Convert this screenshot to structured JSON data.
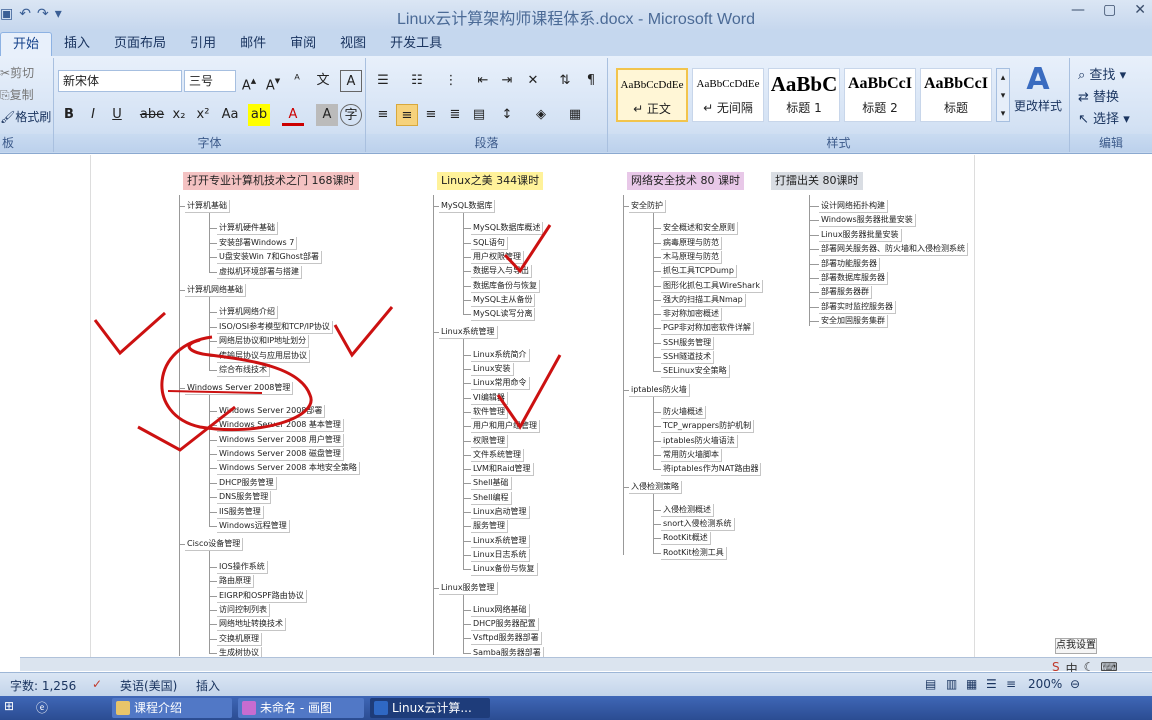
{
  "window": {
    "title": "Linux云计算架构师课程体系.docx - Microsoft Word"
  },
  "tabs": [
    "开始",
    "插入",
    "页面布局",
    "引用",
    "邮件",
    "审阅",
    "视图",
    "开发工具"
  ],
  "clipboard": {
    "cut": "剪切",
    "copy": "复制",
    "painter": "格式刷",
    "label": "板"
  },
  "font": {
    "name": "新宋体",
    "size": "三号",
    "label": "字体"
  },
  "paragraph": {
    "label": "段落"
  },
  "styles": {
    "label": "样式",
    "items": [
      {
        "sample": "AaBbCcDdEe",
        "name": "↵ 正文"
      },
      {
        "sample": "AaBbCcDdEe",
        "name": "↵ 无间隔"
      },
      {
        "sample": "AaBbC",
        "name": "标题 1"
      },
      {
        "sample": "AaBbCcI",
        "name": "标题 2"
      },
      {
        "sample": "AaBbCcI",
        "name": "标题"
      }
    ],
    "change": "更改样式"
  },
  "editing": {
    "find": "查找",
    "replace": "替换",
    "select": "选择",
    "label": "编辑"
  },
  "mindmap": {
    "col1": {
      "title": "打开专业计算机技术之门 168课时",
      "groups": [
        {
          "name": "计算机基础",
          "items": [
            "计算机硬件基础",
            "安装部署Windows 7",
            "U盘安装Win 7和Ghost部署",
            "虚拟机环境部署与搭建"
          ]
        },
        {
          "name": "计算机网络基础",
          "items": [
            "计算机网络介绍",
            "ISO/OSI参考模型和TCP/IP协议",
            "网络层协议和IP地址划分",
            "传输层协议与应用层协议",
            "综合布线技术"
          ]
        },
        {
          "name": "Windows Server 2008管理",
          "items": [
            "Windows Server 2008部署",
            "Windows Server 2008 基本管理",
            "Windows Server 2008 用户管理",
            "Windows Server 2008 磁盘管理",
            "Windows Server 2008 本地安全策略",
            "DHCP服务管理",
            "DNS服务管理",
            "IIS服务管理",
            "Windows远程管理"
          ]
        },
        {
          "name": "Cisco设备管理",
          "items": [
            "IOS操作系统",
            "路由原理",
            "EIGRP和OSPF路由协议",
            "访问控制列表",
            "网络地址转换技术",
            "交换机原理",
            "生成树协议"
          ]
        }
      ]
    },
    "col2": {
      "title": "Linux之美 344课时",
      "groups": [
        {
          "name": "MySQL数据库",
          "items": [
            "MySQL数据库概述",
            "SQL语句",
            "用户权限管理",
            "数据导入与导出",
            "数据库备份与恢复",
            "MySQL主从备份",
            "MySQL读写分离"
          ]
        },
        {
          "name": "Linux系统管理",
          "items": [
            "Linux系统简介",
            "Linux安装",
            "Linux常用命令",
            "VI编辑器",
            "软件管理",
            "用户和用户组管理",
            "权限管理",
            "文件系统管理",
            "LVM和Raid管理",
            "Shell基础",
            "Shell编程",
            "Linux启动管理",
            "服务管理",
            "Linux系统管理",
            "Linux日志系统",
            "Linux备份与恢复"
          ]
        },
        {
          "name": "Linux服务管理",
          "items": [
            "Linux网络基础",
            "DHCP服务器配置",
            "Vsftpd服务器部署",
            "Samba服务器部署"
          ]
        }
      ]
    },
    "col3": {
      "title": "网络安全技术 80 课时",
      "groups": [
        {
          "name": "安全防护",
          "items": [
            "安全概述和安全原则",
            "病毒原理与防范",
            "木马原理与防范",
            "抓包工具TCPDump",
            "图形化抓包工具WireShark",
            "强大的扫描工具Nmap",
            "非对称加密概述",
            "PGP非对称加密软件详解",
            "SSH服务管理",
            "SSH隧道技术",
            "SELinux安全策略"
          ]
        },
        {
          "name": "iptables防火墙",
          "items": [
            "防火墙概述",
            "TCP_wrappers防护机制",
            "iptables防火墙语法",
            "常用防火墙脚本",
            "将iptables作为NAT路由器"
          ]
        },
        {
          "name": "入侵检测策略",
          "items": [
            "入侵检测概述",
            "snort入侵检测系统",
            "RootKit概述",
            "RootKit检测工具"
          ]
        }
      ]
    },
    "col4": {
      "title": "打擂出关 80课时",
      "items": [
        "设计网络拓扑构建",
        "Windows服务器批量安装",
        "Linux服务器批量安装",
        "部署网关服务器、防火墙和入侵检测系统",
        "部署功能服务器",
        "部署数据库服务器",
        "部署服务器群",
        "部署实时监控服务器",
        "安全加固服务集群"
      ]
    }
  },
  "status": {
    "words": "字数: 1,256",
    "lang": "英语(美国)",
    "mode": "插入",
    "zoom": "200%"
  },
  "tray": {
    "settings": "点我设置",
    "ime": "中"
  },
  "taskbar": {
    "t1": "课程介绍",
    "t2": "未命名 - 画图",
    "t3": "Linux云计算..."
  },
  "colors": {
    "col1": "#f4c2c2",
    "col2": "#fff29a",
    "col3": "#e8c8e8",
    "col4": "#d9dde3",
    "ink": "#cc1111"
  }
}
